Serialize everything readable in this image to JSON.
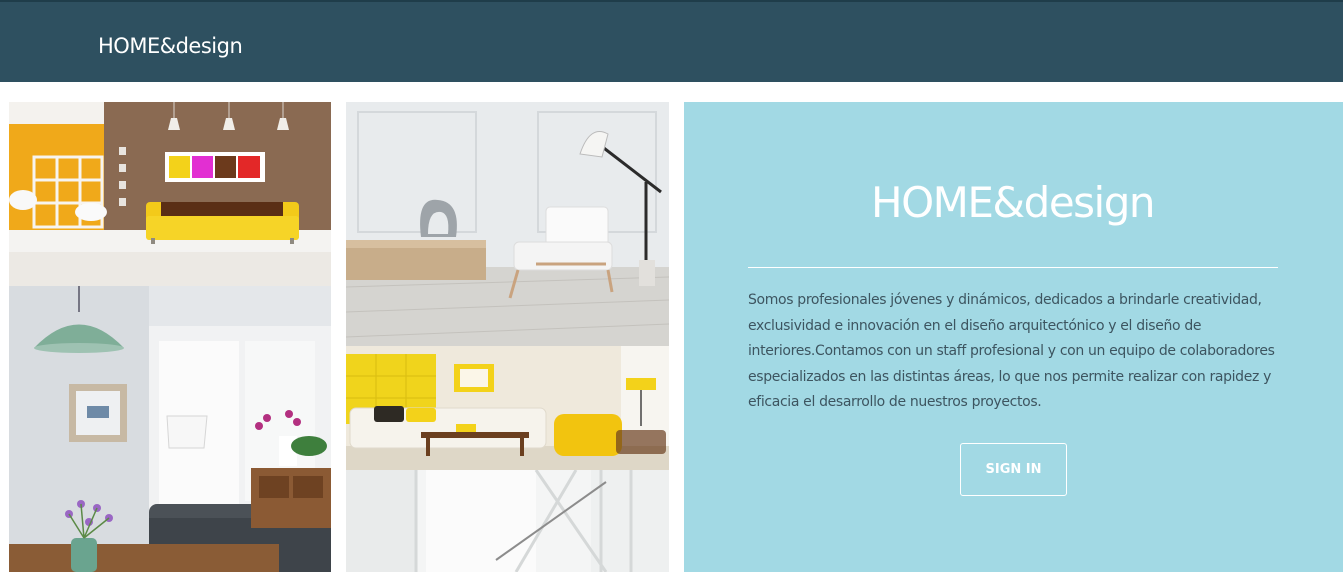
{
  "header": {
    "brand": "HOME&design",
    "background_color": "#2e5060"
  },
  "gallery": {
    "images": [
      {
        "name": "living-room-yellow-sofa-photo",
        "subject": "living room with yellow sofa"
      },
      {
        "name": "living-room-lamp-photo",
        "subject": "bright living room with pendant lamp"
      },
      {
        "name": "white-chair-floor-lamp-photo",
        "subject": "white armchair with floor lamp"
      },
      {
        "name": "white-sofa-yellow-chairs-photo",
        "subject": "white sofa and yellow armchairs"
      },
      {
        "name": "staircase-photo",
        "subject": "white staircase and window"
      }
    ]
  },
  "panel": {
    "background_color": "#a2d9e4",
    "title": "HOME&design",
    "description": "Somos profesionales jóvenes y dinámicos, dedicados a brindarle creatividad, exclusividad e innovación en el diseño arquitectónico y el diseño de interiores.Contamos con un staff profesional y con un equipo de colaboradores especializados en las distintas áreas, lo que nos permite realizar con rapidez y eficacia el desarrollo de nuestros proyectos.",
    "button_label": "SIGN IN"
  }
}
